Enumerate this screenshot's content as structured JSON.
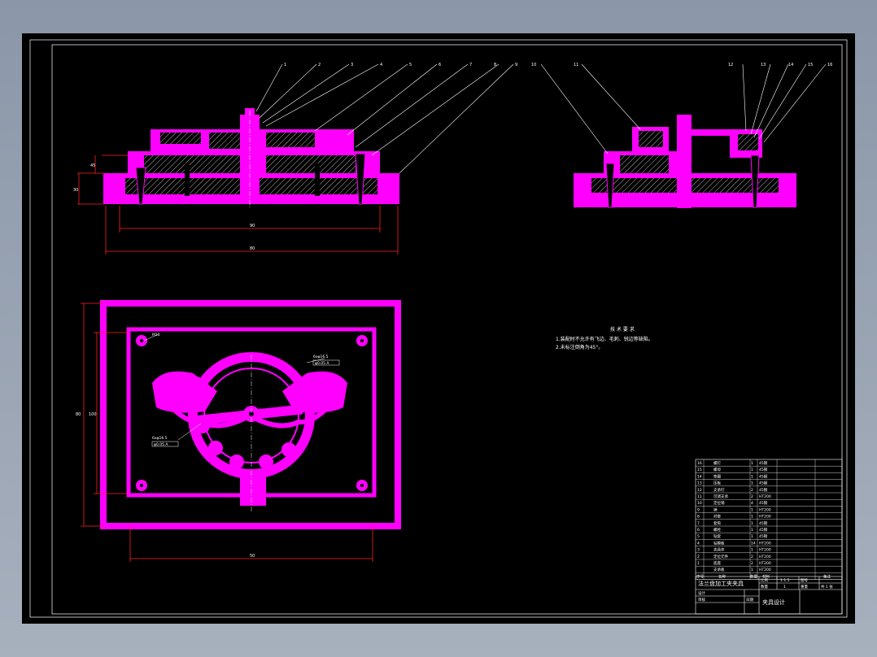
{
  "balloons_left": [
    "1",
    "2",
    "3",
    "4",
    "5",
    "6",
    "7",
    "8",
    "9"
  ],
  "balloons_right": [
    "10",
    "11",
    "12",
    "13",
    "14",
    "15",
    "16"
  ],
  "dims": {
    "front_inner": "90",
    "front_outer": "80",
    "front_height_a": "45",
    "front_height_b": "30",
    "top_height_a": "80",
    "top_height_b": "100",
    "top_width": "50"
  },
  "hole_labels": {
    "corner": "M10",
    "upper_right_a": "6xφ16.5",
    "upper_right_b": "φ0.05 A",
    "lower_left_a": "6xφ16.5",
    "lower_left_b": "φ0.05 A"
  },
  "tech_req": {
    "title": "技 术 要 求",
    "line1": "1.装配时不允许有飞边、毛刺、锐边等缺陷。",
    "line2": "2.未标注倒角为45°。"
  },
  "bom_rows": [
    {
      "no": "16",
      "name": "螺钉",
      "qty": "1",
      "mat": "45钢"
    },
    {
      "no": "15",
      "name": "螺母",
      "qty": "1",
      "mat": "45钢"
    },
    {
      "no": "14",
      "name": "垫圈",
      "qty": "1",
      "mat": "45钢"
    },
    {
      "no": "13",
      "name": "压板",
      "qty": "1",
      "mat": "45钢"
    },
    {
      "no": "12",
      "name": "支承钉",
      "qty": "2",
      "mat": "45钢"
    },
    {
      "no": "11",
      "name": "可调支承",
      "qty": "2",
      "mat": "HT200"
    },
    {
      "no": "10",
      "name": "定位销",
      "qty": "4",
      "mat": "45钢"
    },
    {
      "no": "9",
      "name": "销",
      "qty": "1",
      "mat": "HT200"
    },
    {
      "no": "8",
      "name": "衬套",
      "qty": "1",
      "mat": "HT200"
    },
    {
      "no": "7",
      "name": "套筒",
      "qty": "1",
      "mat": "45钢"
    },
    {
      "no": "6",
      "name": "螺栓",
      "qty": "1",
      "mat": "45钢"
    },
    {
      "no": "5",
      "name": "钻套",
      "qty": "1",
      "mat": "45钢"
    },
    {
      "no": "4",
      "name": "钻模板",
      "qty": "14",
      "mat": "HT200"
    },
    {
      "no": "3",
      "name": "夹具体",
      "qty": "1",
      "mat": "HT200"
    },
    {
      "no": "2",
      "name": "定位元件",
      "qty": "2",
      "mat": "HT200"
    },
    {
      "no": "1",
      "name": "底座",
      "qty": "2",
      "mat": "HT200"
    },
    {
      "no": "",
      "name": "支承板",
      "qty": "1",
      "mat": "HT200"
    }
  ],
  "bom_header": {
    "no": "序号",
    "name": "名称",
    "qty": "数量",
    "mat": "材料",
    "note": "备注"
  },
  "title_block": {
    "part_name": "法兰盘加工夹夹具",
    "ratio_label": "比例",
    "ratio": "1:1.5",
    "sheet_label": "图号",
    "qty_label": "数量",
    "sheet_val": "1",
    "weight_label": "重量",
    "drawing_no": "共 1 张",
    "designer_label": "设计",
    "checker_label": "审核",
    "date_label": "日期",
    "course": "夹具设计"
  }
}
